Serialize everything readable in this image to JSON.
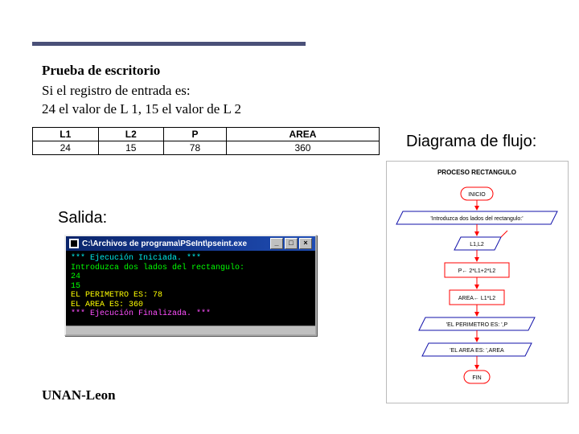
{
  "heading": {
    "title": "Prueba de escritorio",
    "line1": " Si el registro de entrada es:",
    "line2": "24 el valor de L 1, 15 el valor de L 2"
  },
  "table": {
    "headers": [
      "L1",
      "L2",
      "P",
      "AREA"
    ],
    "row": [
      "24",
      "15",
      "78",
      "360"
    ]
  },
  "salida_label": "Salida:",
  "console": {
    "title": "C:\\Archivos de programa\\PSeInt\\pseint.exe",
    "min": "_",
    "max": "□",
    "close": "×",
    "l1": "*** Ejecución Iniciada. ***",
    "l2": "Introduzca dos lados del rectangulo:",
    "l3": " 24",
    "l4": " 15",
    "l5": "EL PERIMETRO ES: 78",
    "l6": "EL AREA ES: 360",
    "l7": "*** Ejecución Finalizada. ***"
  },
  "diagram": {
    "title": "Diagrama de flujo:",
    "process": "PROCESO RECTANGULO",
    "start": "INICIO",
    "prompt": "'Introduzca dos lados del rectangulo:'",
    "read": "L1,L2",
    "calc_p": "P← 2*L1+2*L2",
    "calc_a": "AREA← L1*L2",
    "out_p": "'EL PERIMETRO ES: ',P",
    "out_a": "'EL AREA ES: ',AREA",
    "end": "FIN"
  },
  "footer": "UNAN-Leon"
}
